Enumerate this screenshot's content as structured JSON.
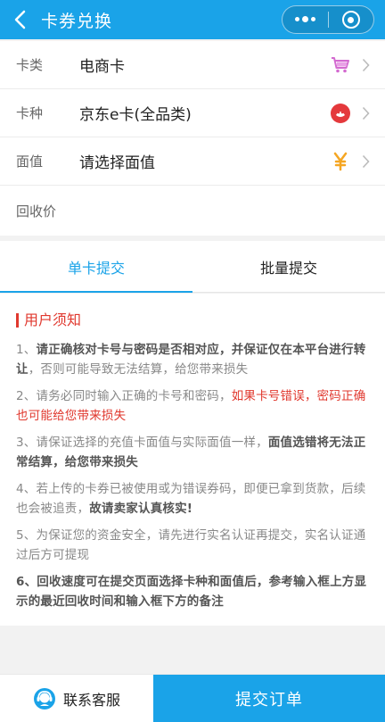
{
  "header": {
    "title": "卡券兑换"
  },
  "form": {
    "card_type": {
      "label": "卡类",
      "value": "电商卡",
      "icon": "shopping-cart-icon"
    },
    "card_kind": {
      "label": "卡种",
      "value": "京东e卡(全品类)",
      "icon": "jd-logo-icon"
    },
    "face_value": {
      "label": "面值",
      "value": "请选择面值",
      "icon": "yen-icon"
    },
    "recycle_price": {
      "label": "回收价",
      "value": ""
    }
  },
  "tabs": [
    {
      "label": "单卡提交",
      "active": true
    },
    {
      "label": "批量提交",
      "active": false
    }
  ],
  "notice": {
    "title": "用户须知",
    "items": [
      {
        "num": "1、",
        "bold": "请正确核对卡号与密码是否相对应，并保证仅在本平台进行转让",
        "text": "，否则可能导致无法结算，给您带来损失"
      },
      {
        "num": "2、",
        "text": "请务必同时输入正确的卡号和密码，",
        "red": "如果卡号错误，密码正确也可能给您带来损失"
      },
      {
        "num": "3、",
        "text": "请保证选择的充值卡面值与实际面值一样，",
        "bold": "面值选错将无法正常结算，给您带来损失"
      },
      {
        "num": "4、",
        "text": "若上传的卡券已被使用或为错误券码，即便已拿到货款，后续也会被追责，",
        "bold": "故请卖家认真核实!"
      },
      {
        "num": "5、",
        "text": "为保证您的资金安全，请先进行实名认证再提交，实名认证通过后方可提现"
      },
      {
        "num": "6、",
        "bold": "回收速度可在提交页面选择卡种和面值后，参考输入框上方显示的最近回收时间和输入框下方的备注"
      }
    ]
  },
  "bottom": {
    "service_label": "联系客服",
    "submit_label": "提交订单"
  },
  "colors": {
    "primary": "#1aa3e8",
    "warning": "#e0382e"
  }
}
